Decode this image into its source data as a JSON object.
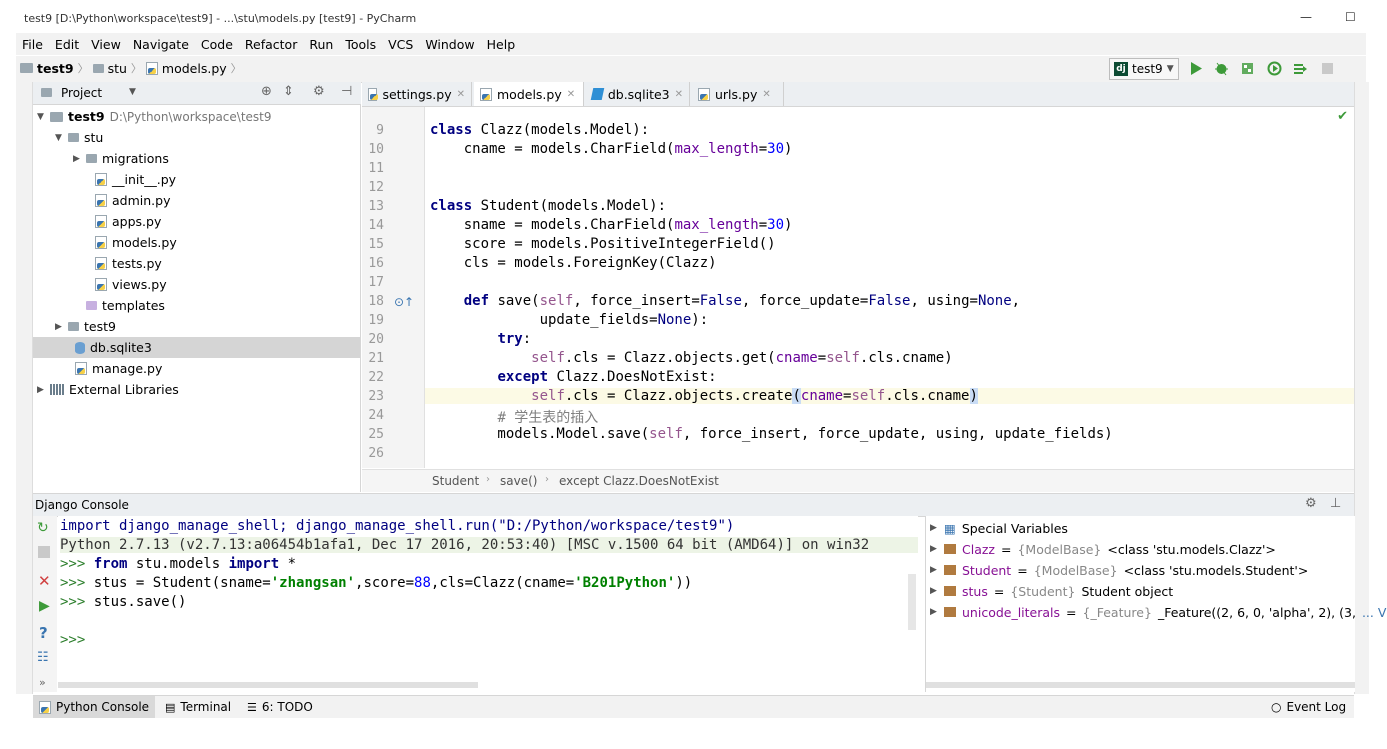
{
  "window": {
    "title": "test9 [D:\\Python\\workspace\\test9] - ...\\stu\\models.py [test9] - PyCharm"
  },
  "menu": [
    "File",
    "Edit",
    "View",
    "Navigate",
    "Code",
    "Refactor",
    "Run",
    "Tools",
    "VCS",
    "Window",
    "Help"
  ],
  "navbar": {
    "crumbs": [
      "test9",
      "stu",
      "models.py"
    ],
    "run_config": "test9",
    "dj_label": "dj"
  },
  "project": {
    "header": "Project",
    "root_name": "test9",
    "root_path": "D:\\Python\\workspace\\test9",
    "items": [
      {
        "label": "stu"
      },
      {
        "label": "migrations"
      },
      {
        "label": "__init__.py"
      },
      {
        "label": "admin.py"
      },
      {
        "label": "apps.py"
      },
      {
        "label": "models.py"
      },
      {
        "label": "tests.py"
      },
      {
        "label": "views.py"
      },
      {
        "label": "templates"
      },
      {
        "label": "test9"
      },
      {
        "label": "db.sqlite3"
      },
      {
        "label": "manage.py"
      },
      {
        "label": "External Libraries"
      }
    ]
  },
  "tabs": [
    {
      "label": "settings.py"
    },
    {
      "label": "models.py"
    },
    {
      "label": "db.sqlite3"
    },
    {
      "label": "urls.py"
    }
  ],
  "editor": {
    "line_numbers": [
      "9",
      "10",
      "11",
      "12",
      "13",
      "14",
      "15",
      "16",
      "17",
      "18",
      "19",
      "20",
      "21",
      "22",
      "23",
      "24",
      "25",
      "26"
    ],
    "breadcrumb": [
      "Student",
      "save()",
      "except Clazz.DoesNotExist"
    ]
  },
  "console": {
    "header": "Django Console",
    "lines": {
      "l1": "import django_manage_shell; django_manage_shell.run(\"D:/Python/workspace/test9\")",
      "l2": "Python 2.7.13 (v2.7.13:a06454b1afa1, Dec 17 2016, 20:53:40) [MSC v.1500 64 bit (AMD64)] on win32"
    }
  },
  "variables": {
    "special": "Special Variables",
    "rows": [
      {
        "name": "Clazz",
        "type": "{ModelBase}",
        "value": "<class 'stu.models.Clazz'>"
      },
      {
        "name": "Student",
        "type": "{ModelBase}",
        "value": "<class 'stu.models.Student'>"
      },
      {
        "name": "stus",
        "type": "{Student}",
        "value": "Student object"
      },
      {
        "name": "unicode_literals",
        "type": "{_Feature}",
        "value": "_Feature((2, 6, 0, 'alpha', 2), (3,",
        "more": "... View"
      }
    ]
  },
  "bottom_tabs": [
    {
      "label": "Python Console"
    },
    {
      "label": "Terminal"
    },
    {
      "label": "6: TODO"
    }
  ],
  "event_log": "Event Log"
}
